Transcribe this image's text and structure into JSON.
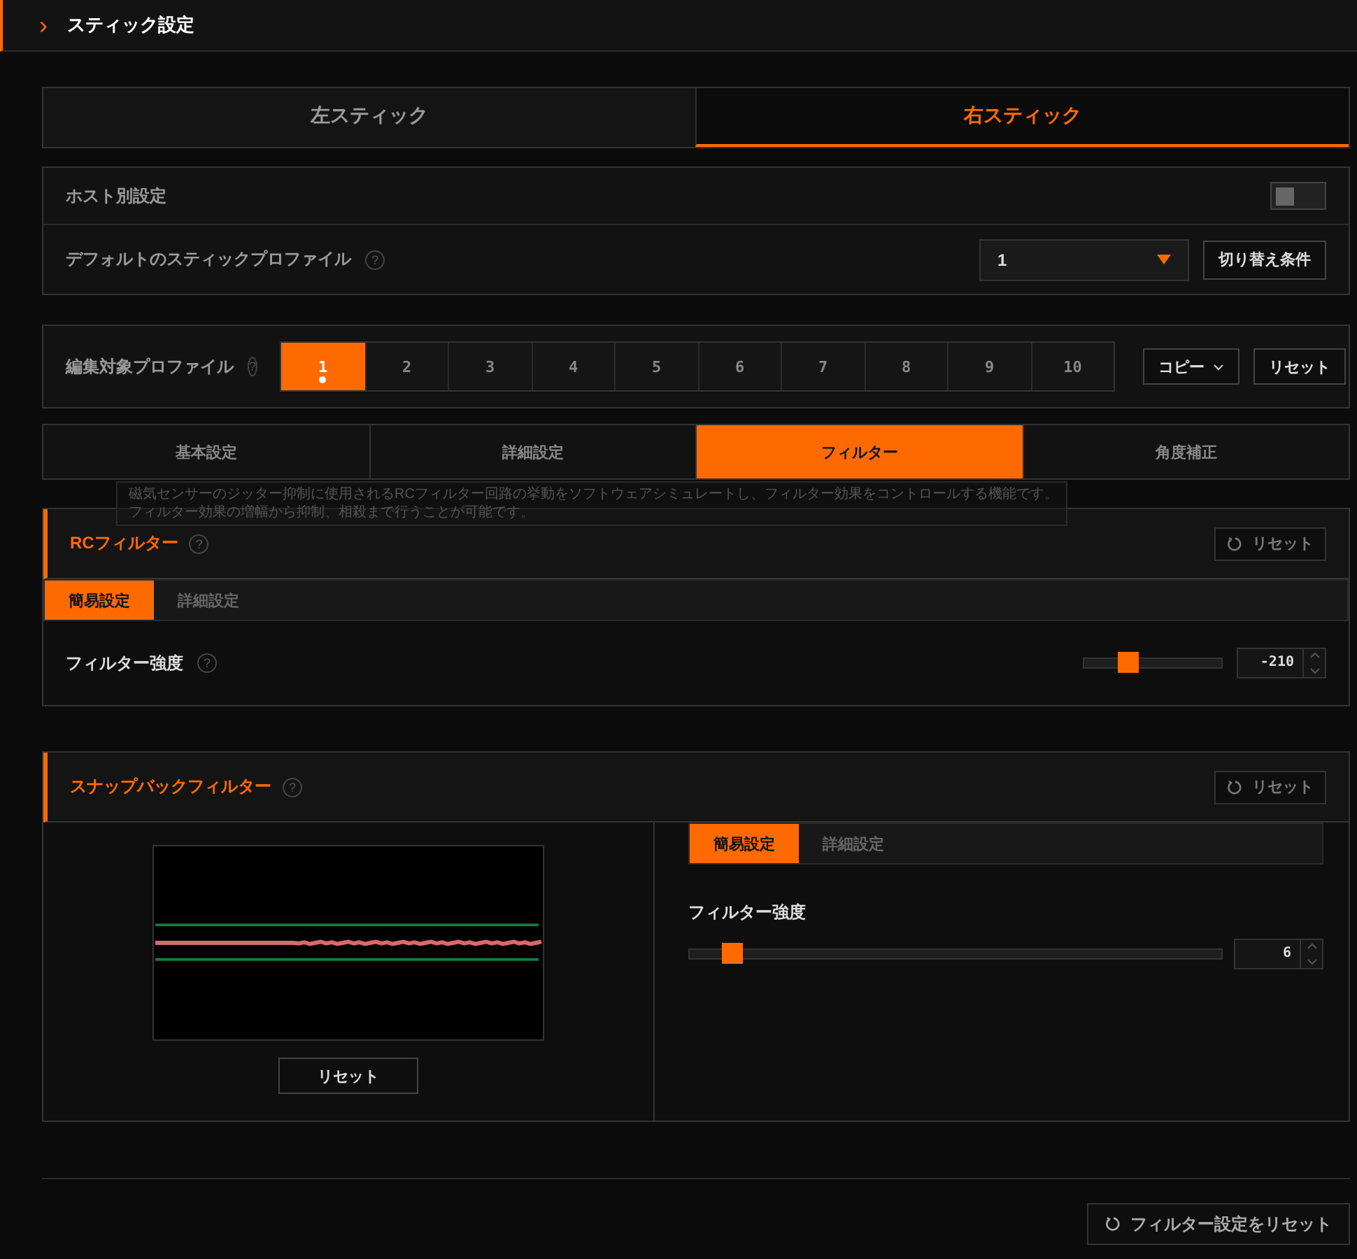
{
  "header": {
    "chevron": "›",
    "title": "スティック設定"
  },
  "stick_tabs": [
    {
      "label": "左スティック",
      "selected": false
    },
    {
      "label": "右スティック",
      "selected": true
    }
  ],
  "host_settings": {
    "label": "ホスト別設定",
    "on": false
  },
  "default_profile": {
    "label": "デフォルトのスティックプロファイル",
    "help": "?",
    "value": "1",
    "switch_button": "切り替え条件"
  },
  "edit_profile": {
    "label": "編集対象プロファイル",
    "help": "?",
    "copy_button": "コピー",
    "reset_button": "リセット",
    "profiles": [
      {
        "label": "1",
        "selected": true,
        "dot": true
      },
      {
        "label": "2",
        "selected": false,
        "dot": false
      },
      {
        "label": "3",
        "selected": false,
        "dot": false
      },
      {
        "label": "4",
        "selected": false,
        "dot": false
      },
      {
        "label": "5",
        "selected": false,
        "dot": false
      },
      {
        "label": "6",
        "selected": false,
        "dot": false
      },
      {
        "label": "7",
        "selected": false,
        "dot": false
      },
      {
        "label": "8",
        "selected": false,
        "dot": false
      },
      {
        "label": "9",
        "selected": false,
        "dot": false
      },
      {
        "label": "10",
        "selected": false,
        "dot": false
      }
    ]
  },
  "setting_tabs": [
    {
      "label": "基本設定",
      "selected": false
    },
    {
      "label": "詳細設定",
      "selected": false
    },
    {
      "label": "フィルター",
      "selected": true
    },
    {
      "label": "角度補正",
      "selected": false
    }
  ],
  "tooltip": {
    "lines": [
      "磁気センサーのジッター抑制に使用されるRCフィルター回路の挙動をソフトウェアシミュレートし、フィルター効果をコントロールする機能です。",
      "フィルター効果の増幅から抑制、相殺まで行うことが可能です。"
    ]
  },
  "rc_filter": {
    "title": "RCフィルター",
    "help": "?",
    "reset_button": "リセット",
    "tabs": [
      {
        "label": "簡易設定",
        "selected": true
      },
      {
        "label": "詳細設定",
        "selected": false
      }
    ],
    "strength": {
      "label": "フィルター強度",
      "help": "?",
      "level": 0.32,
      "value": "-210"
    }
  },
  "snapback_filter": {
    "title": "スナップバックフィルター",
    "help": "?",
    "reset_button": "リセット",
    "graph_reset_button": "リセット",
    "tabs": [
      {
        "label": "簡易設定",
        "selected": true
      },
      {
        "label": "詳細設定",
        "selected": false
      }
    ],
    "strength": {
      "label": "フィルター強度",
      "level": 0.08,
      "value": "6"
    }
  },
  "reset_all_button": "フィルター設定をリセット"
}
